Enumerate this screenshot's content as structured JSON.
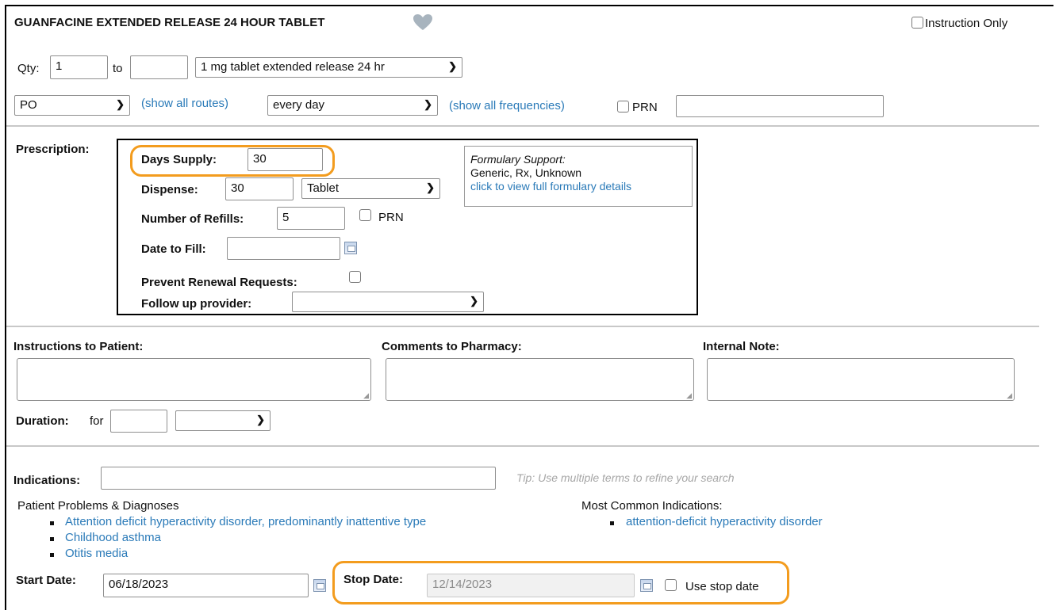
{
  "header": {
    "drug_name": "GUANFACINE EXTENDED RELEASE 24 HOUR TABLET",
    "favorite_icon": "heart-icon",
    "instruction_only_label": "Instruction Only"
  },
  "sig": {
    "qty_label": "Qty:",
    "qty_value": "1",
    "to_label": "to",
    "qty_to_value": "",
    "form_selected": "1 mg tablet extended release 24 hr",
    "route_selected": "PO",
    "show_all_routes": "(show all routes)",
    "frequency_selected": "every day",
    "show_all_frequencies": "(show all frequencies)",
    "prn_label": "PRN",
    "prn_text": ""
  },
  "prescription": {
    "section_label": "Prescription:",
    "days_supply_label": "Days Supply:",
    "days_supply_value": "30",
    "dispense_label": "Dispense:",
    "dispense_value": "30",
    "dispense_unit": "Tablet",
    "refills_label": "Number of Refills:",
    "refills_value": "5",
    "refills_prn_label": "PRN",
    "date_to_fill_label": "Date to Fill:",
    "date_to_fill_value": "",
    "prevent_renewal_label": "Prevent Renewal Requests:",
    "follow_up_label": "Follow up provider:",
    "follow_up_value": "",
    "formulary": {
      "title": "Formulary Support:",
      "status": "Generic, Rx, Unknown",
      "link": "click to view full formulary details"
    }
  },
  "notes": {
    "instructions_label": "Instructions to Patient:",
    "comments_label": "Comments to Pharmacy:",
    "internal_label": "Internal Note:",
    "duration_label": "Duration:",
    "duration_for": "for",
    "duration_value": "",
    "duration_unit": ""
  },
  "indications": {
    "label": "Indications:",
    "value": "",
    "tip": "Tip: Use multiple terms to refine your search",
    "problems_title": "Patient Problems & Diagnoses",
    "problems": [
      "Attention deficit hyperactivity disorder, predominantly inattentive type",
      "Childhood asthma",
      "Otitis media"
    ],
    "common_title": "Most Common Indications:",
    "common": [
      "attention-deficit hyperactivity disorder"
    ]
  },
  "dates": {
    "start_label": "Start Date:",
    "start_value": "06/18/2023",
    "stop_label": "Stop Date:",
    "stop_value": "12/14/2023",
    "use_stop_label": "Use stop date"
  },
  "colors": {
    "link": "#2a7ab8",
    "highlight": "#f39c1e",
    "divider": "#c8c8c8"
  }
}
